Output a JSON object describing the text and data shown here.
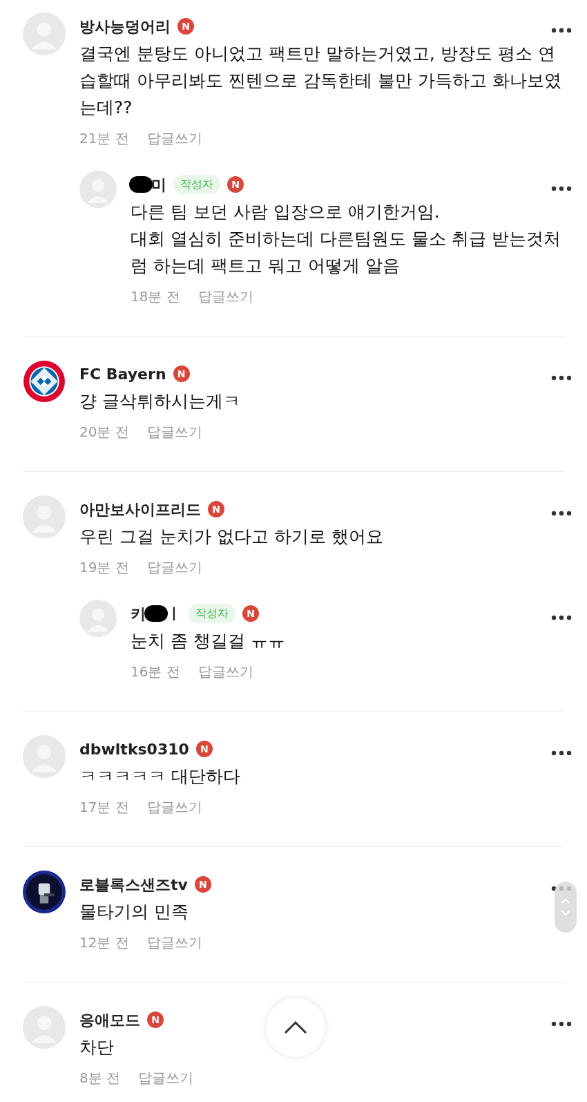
{
  "comments": [
    {
      "kind": "default",
      "name": "방사능덩어리",
      "new_badge": "N",
      "body": "결국엔 분탕도 아니었고 팩트만 말하는거였고, 방장도 평소 연습할때 아무리봐도 찐텐으로 감독한테 불만 가득하고 화나보였는데??",
      "time": "21분 전",
      "reply": "답글쓰기",
      "children": [
        {
          "kind": "default",
          "redacted": true,
          "name_after": "미",
          "author_badge": "작성자",
          "new_badge": "N",
          "body": "다른 팀 보던 사람 입장으로 얘기한거임.\n대회 열심히 준비하는데 다른팀원도 물소 취급 받는것처럼 하는데 팩트고 뭐고 어떻게 알음",
          "time": "18분 전",
          "reply": "답글쓰기"
        }
      ]
    },
    {
      "kind": "crest",
      "name": "FC Bayern",
      "new_badge": "N",
      "body": "걍 글삭튀하시는게ㅋ",
      "time": "20분 전",
      "reply": "답글쓰기"
    },
    {
      "kind": "default",
      "name": "아만보사이프리드",
      "new_badge": "N",
      "body": "우린 그걸 눈치가 없다고 하기로 했어요",
      "time": "19분 전",
      "reply": "답글쓰기",
      "children": [
        {
          "kind": "default",
          "name": "키",
          "redacted": true,
          "name_after": "ㅣ",
          "author_badge": "작성자",
          "new_badge": "N",
          "body": "눈치 좀 챙길걸 ㅠㅠ",
          "time": "16분 전",
          "reply": "답글쓰기"
        }
      ]
    },
    {
      "kind": "default",
      "name": "dbwltks0310",
      "new_badge": "N",
      "body": "ㅋㅋㅋㅋㅋ 대단하다",
      "time": "17분 전",
      "reply": "답글쓰기"
    },
    {
      "kind": "picture",
      "name": "로블록스샌즈tv",
      "new_badge": "N",
      "body": "물타기의 민족",
      "time": "12분 전",
      "reply": "답글쓰기"
    },
    {
      "kind": "default",
      "name": "응애모드",
      "new_badge": "N",
      "body": "차단",
      "time": "8분 전",
      "reply": "답글쓰기"
    }
  ],
  "scroll_to_top": {
    "shown": true
  }
}
